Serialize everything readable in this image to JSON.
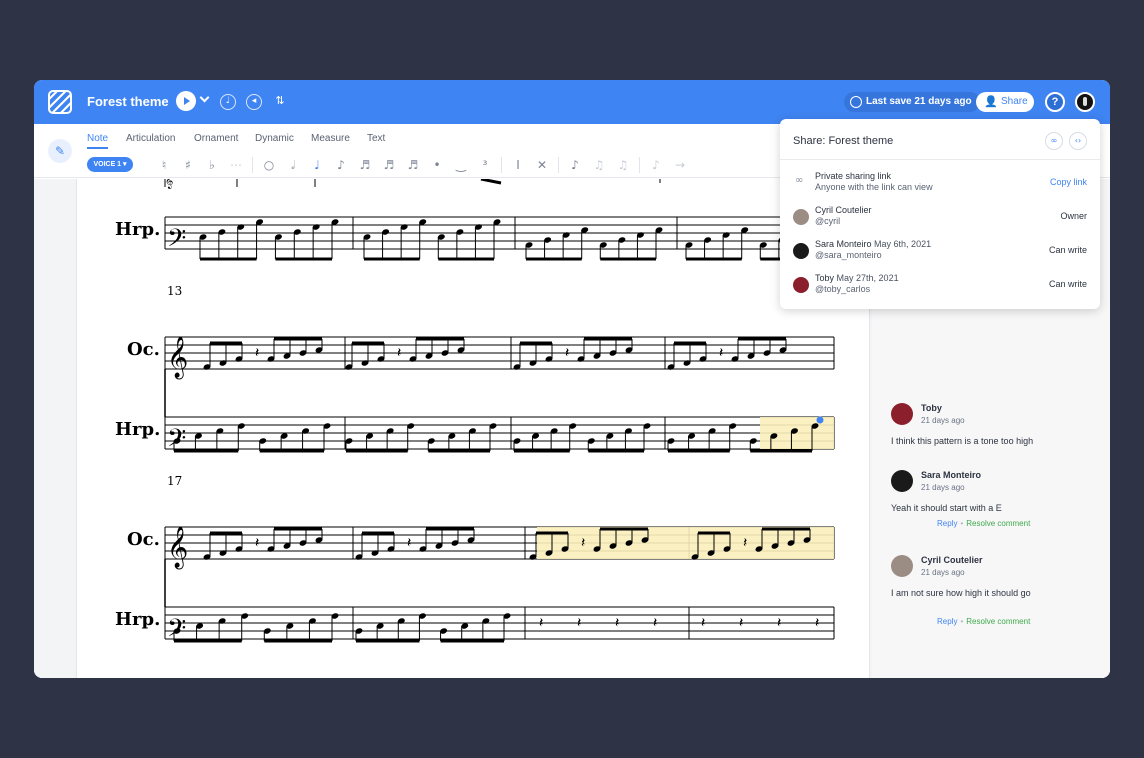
{
  "app": {
    "title": "Forest theme",
    "last_save": "Last save 21 days ago",
    "share_label": "Share",
    "help_label": "?"
  },
  "ribbon": {
    "tabs": [
      "Note",
      "Articulation",
      "Ornament",
      "Dynamic",
      "Measure",
      "Text"
    ],
    "active_tab": "Note",
    "voice_label": "VOICE 1 ▾"
  },
  "score": {
    "instruments": [
      "Oc.",
      "Hrp."
    ],
    "measure_numbers": [
      "13",
      "17"
    ]
  },
  "share_panel": {
    "title": "Share: Forest theme",
    "private_link": {
      "label": "Private sharing link",
      "sub": "Anyone with the link can view",
      "action": "Copy link"
    },
    "members": [
      {
        "name": "Cyril Coutelier",
        "date": "",
        "handle": "@cyril",
        "role": "Owner"
      },
      {
        "name": "Sara Monteiro",
        "date": "May 6th, 2021",
        "handle": "@sara_monteiro",
        "role": "Can write"
      },
      {
        "name": "Toby",
        "date": "May 27th, 2021",
        "handle": "@toby_carlos",
        "role": "Can write"
      }
    ]
  },
  "comments": [
    {
      "author": "Toby",
      "time": "21 days ago",
      "text": "I think this pattern is a tone too high"
    },
    {
      "author": "Sara Monteiro",
      "time": "21 days ago",
      "text": "Yeah it should start with a E",
      "reply": "Reply",
      "resolve": "Resolve comment"
    },
    {
      "author": "Cyril Coutelier",
      "time": "21 days ago",
      "text": "I am not sure how high it should go",
      "reply": "Reply",
      "resolve": "Resolve comment"
    }
  ],
  "colors": {
    "accent": "#3f84f3",
    "background": "#2e3345",
    "highlight": "#fbeebb",
    "resolve": "#3daa4a"
  }
}
